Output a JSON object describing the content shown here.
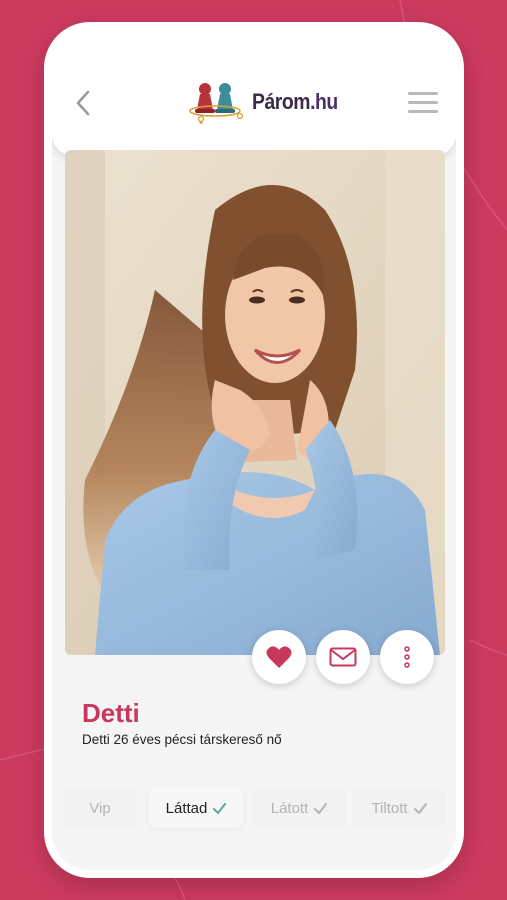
{
  "header": {
    "logo_text": "Párom",
    "logo_suffix": ".hu"
  },
  "profile": {
    "name": "Detti",
    "description": "Detti 26 éves pécsi társkereső nő"
  },
  "tabs": [
    {
      "label": "Vip",
      "checked": false,
      "active": false
    },
    {
      "label": "Láttad",
      "checked": true,
      "active": true
    },
    {
      "label": "Látott",
      "checked": true,
      "active": false
    },
    {
      "label": "Tiltott",
      "checked": true,
      "active": false
    }
  ],
  "colors": {
    "brand": "#cc3a5e",
    "name": "#c9375c",
    "check_active": "#5aa7a0"
  },
  "icons": {
    "back": "chevron-left-icon",
    "menu": "hamburger-menu-icon",
    "like": "heart-icon",
    "message": "envelope-icon",
    "more": "more-vertical-icon"
  }
}
